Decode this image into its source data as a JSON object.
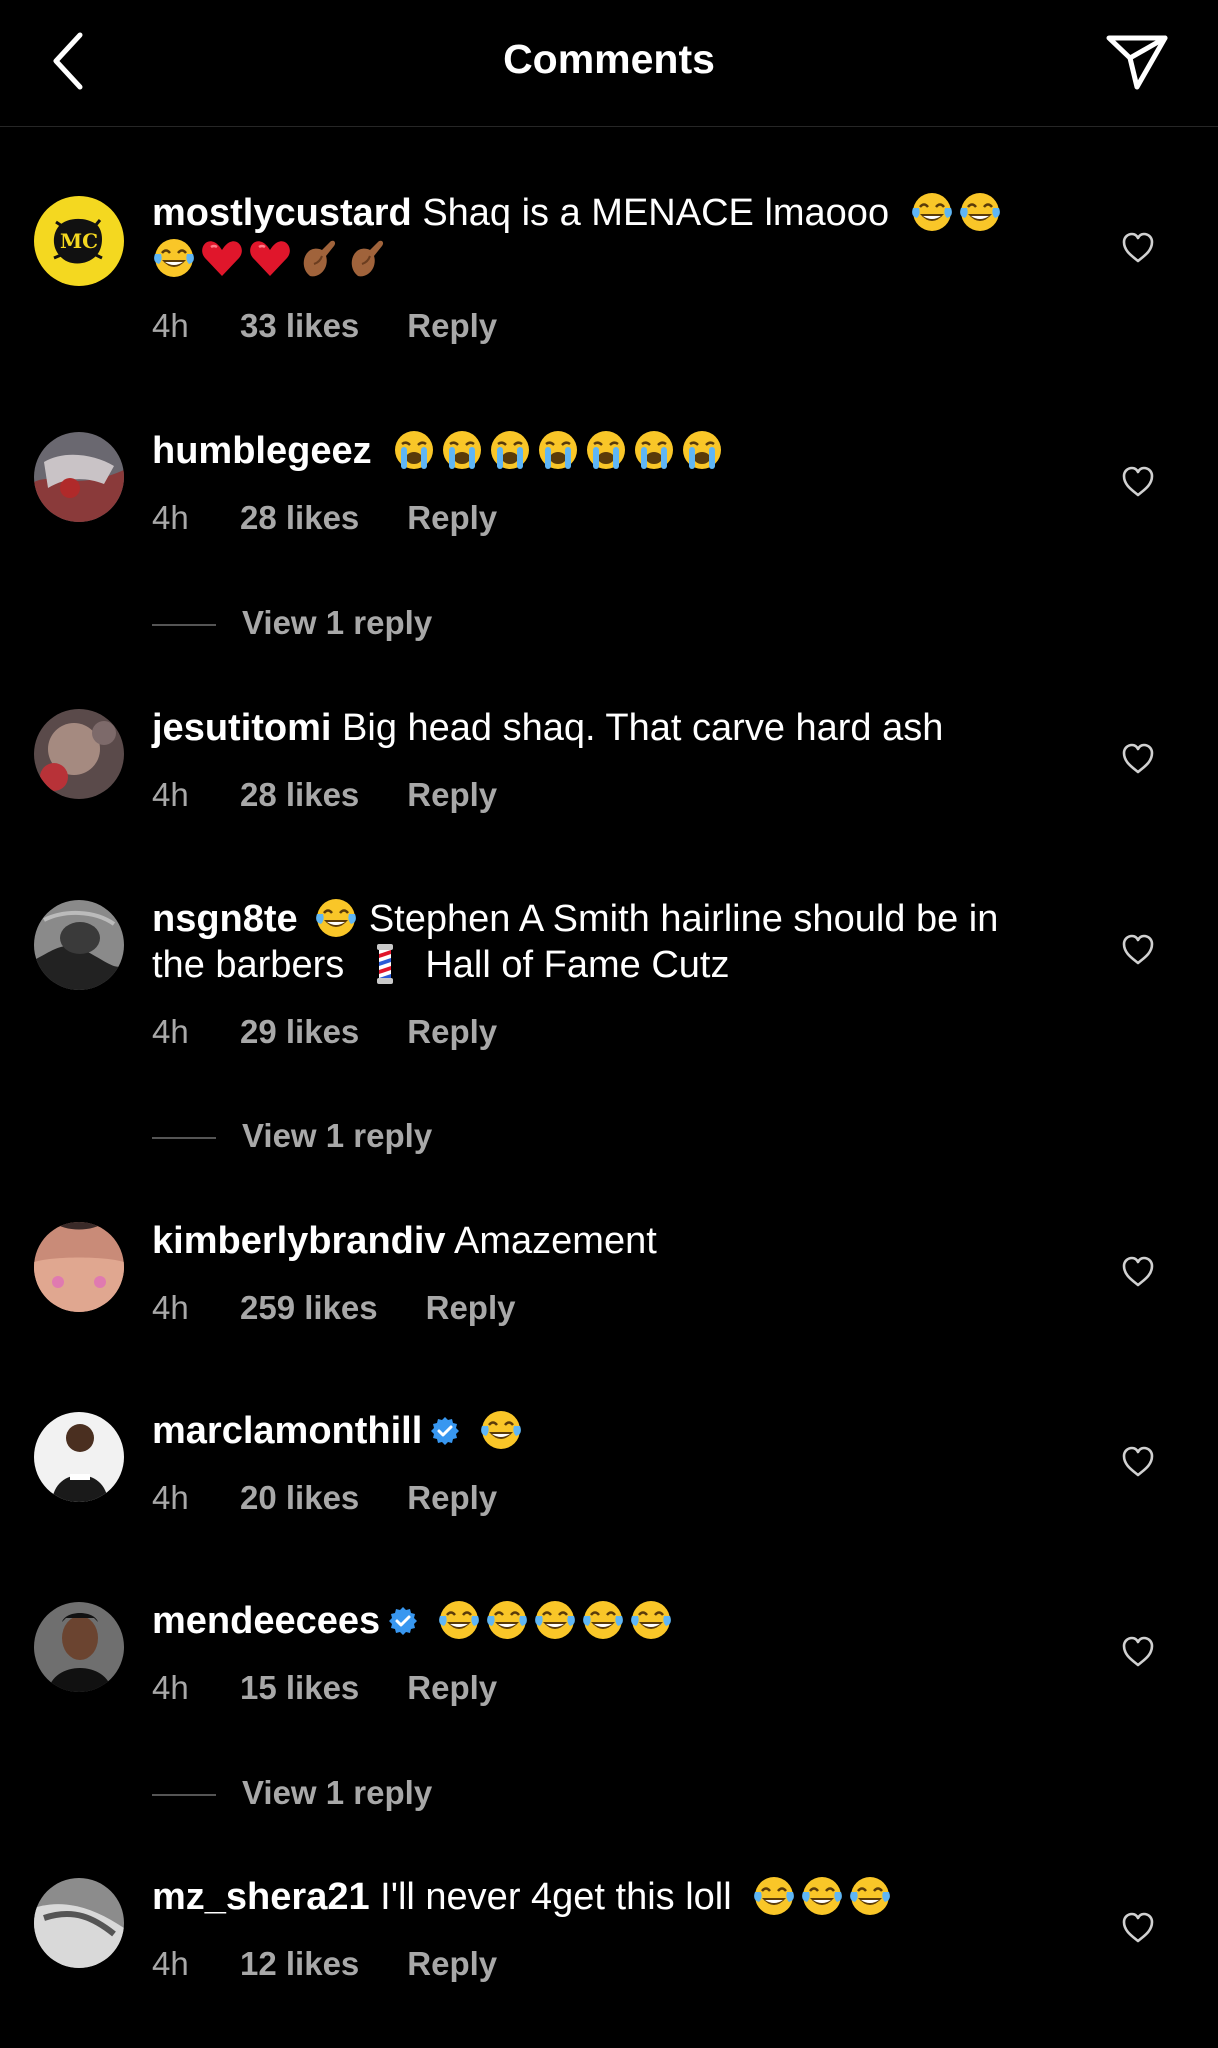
{
  "header": {
    "title": "Comments",
    "back_icon": "chevron-left-icon",
    "share_icon": "paper-plane-icon"
  },
  "colors": {
    "background": "#000000",
    "text": "#ffffff",
    "meta_text": "#a8a8a8",
    "verified_badge": "#3897f0"
  },
  "comments": [
    {
      "username": "mostlycustard",
      "text": "Shaq is a MENACE lmaooo",
      "emojis_line1": [
        "face-with-tears-of-joy",
        "face-with-tears-of-joy"
      ],
      "emojis_line2": [
        "face-with-tears-of-joy",
        "red-heart",
        "red-heart",
        "pinching-hand",
        "pinching-hand"
      ],
      "time": "4h",
      "likes": "33 likes",
      "reply": "Reply",
      "avatar_text": "MC"
    },
    {
      "username": "humblegeez",
      "text": "",
      "emojis": [
        "loudly-crying-face",
        "loudly-crying-face",
        "loudly-crying-face",
        "loudly-crying-face",
        "loudly-crying-face",
        "loudly-crying-face",
        "loudly-crying-face"
      ],
      "time": "4h",
      "likes": "28 likes",
      "reply": "Reply",
      "view_replies": "View 1 reply"
    },
    {
      "username": "jesutitomi",
      "text": "Big head shaq. That carve hard ash",
      "time": "4h",
      "likes": "28 likes",
      "reply": "Reply"
    },
    {
      "username": "nsgn8te",
      "text_before": "Stephen A Smith hairline should be in the barbers",
      "text_after": "Hall of Fame Cutz",
      "emojis": [
        "face-with-tears-of-joy",
        "barber-pole"
      ],
      "time": "4h",
      "likes": "29 likes",
      "reply": "Reply",
      "view_replies": "View 1 reply"
    },
    {
      "username": "kimberlybrandiv",
      "text": "Amazement",
      "time": "4h",
      "likes": "259 likes",
      "reply": "Reply"
    },
    {
      "username": "marclamonthill",
      "verified": true,
      "text": "",
      "emojis": [
        "face-with-tears-of-joy"
      ],
      "time": "4h",
      "likes": "20 likes",
      "reply": "Reply"
    },
    {
      "username": "mendeecees",
      "verified": true,
      "text": "",
      "emojis": [
        "face-with-tears-of-joy",
        "face-with-tears-of-joy",
        "face-with-tears-of-joy",
        "face-with-tears-of-joy",
        "face-with-tears-of-joy"
      ],
      "time": "4h",
      "likes": "15 likes",
      "reply": "Reply",
      "view_replies": "View 1 reply"
    },
    {
      "username": "mz_shera21",
      "text": "I'll never 4get this loll",
      "emojis": [
        "face-with-tears-of-joy",
        "face-with-tears-of-joy",
        "face-with-tears-of-joy"
      ],
      "time": "4h",
      "likes": "12 likes",
      "reply": "Reply"
    }
  ]
}
